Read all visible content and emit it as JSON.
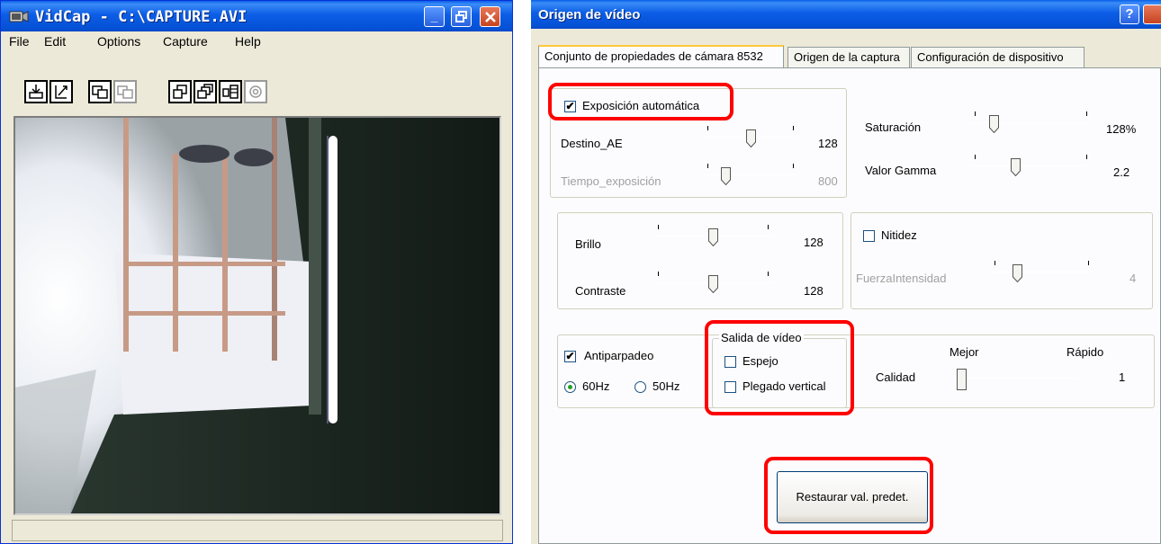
{
  "vidcap": {
    "title": "VidCap - C:\\CAPTURE.AVI",
    "menu": [
      "File",
      "Edit",
      "Options",
      "Capture",
      "Help"
    ],
    "toolbar_icons": [
      "set-capture-file-icon",
      "save-captured-video-icon",
      "preview-icon",
      "overlay-icon",
      "video-format-icon",
      "video-source-icon",
      "video-display-icon",
      "compression-icon"
    ]
  },
  "origen": {
    "title": "Origen de vídeo",
    "tabs": [
      "Conjunto de propiedades de cámara 8532",
      "Origen de la captura",
      "Configuración de dispositivo"
    ],
    "exposure": {
      "auto_label": "Exposición automática",
      "auto_checked": true,
      "destino_label": "Destino_AE",
      "destino_value": "128",
      "tiempo_label": "Tiempo_exposición",
      "tiempo_value": "800"
    },
    "color": {
      "saturacion_label": "Saturación",
      "saturacion_value": "128%",
      "gamma_label": "Valor Gamma",
      "gamma_value": "2.2"
    },
    "brightness": {
      "brillo_label": "Brillo",
      "brillo_value": "128",
      "contraste_label": "Contraste",
      "contraste_value": "128"
    },
    "sharpness": {
      "nitidez_label": "Nitidez",
      "nitidez_checked": false,
      "fuerza_label": "FuerzaIntensidad",
      "fuerza_value": "4"
    },
    "flicker": {
      "anti_label": "Antiparpadeo",
      "anti_checked": true,
      "hz60_label": "60Hz",
      "hz50_label": "50Hz",
      "selected": "60Hz"
    },
    "video_out": {
      "group_label": "Salida de vídeo",
      "espejo_label": "Espejo",
      "espejo_checked": false,
      "plegado_label": "Plegado vertical",
      "plegado_checked": false
    },
    "quality": {
      "mejor_label": "Mejor",
      "rapido_label": "Rápido",
      "calidad_label": "Calidad",
      "calidad_value": "1"
    },
    "restore_label": "Restaurar val. predet."
  }
}
